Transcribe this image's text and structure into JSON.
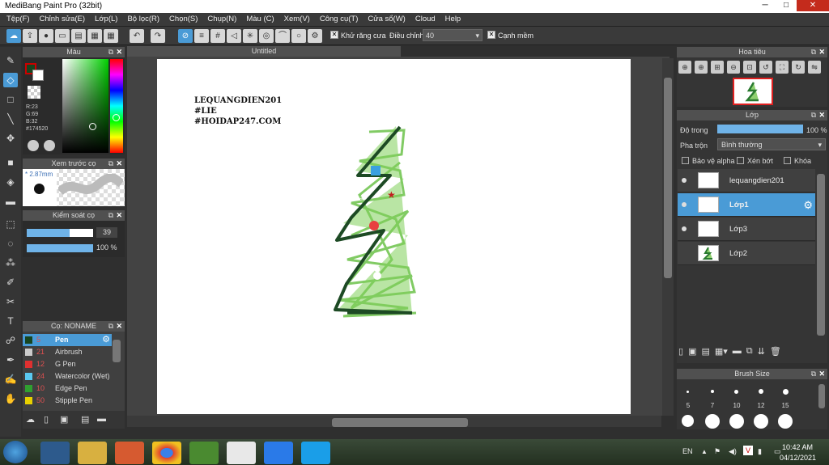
{
  "window": {
    "title": "MediBang Paint Pro (32bit)",
    "min": "─",
    "max": "□",
    "close": "✕"
  },
  "menu": [
    "Tệp(F)",
    "Chỉnh sửa(E)",
    "Lớp(L)",
    "Bộ lọc(R)",
    "Chọn(S)",
    "Chụp(N)",
    "Màu (C)",
    "Xem(V)",
    "Công cụ(T)",
    "Cửa sổ(W)",
    "Cloud",
    "Help"
  ],
  "toolbar": {
    "antialias_label": "Khử răng cưa",
    "adjust_label": "Điều chỉnh",
    "adjust_value": "40",
    "sharp_label": "Cạnh mềm"
  },
  "color_panel": {
    "title": "Màu",
    "r": "R:23",
    "g": "G:69",
    "b": "B:32",
    "hex": "#174520",
    "current_color": "#174520"
  },
  "brush_preview": {
    "title": "Xem trước cọ",
    "size": "* 2.87mm"
  },
  "brush_control": {
    "title": "Kiểm soát cọ",
    "size_value": "39",
    "opacity_value": "100 %",
    "size_fraction": 0.39,
    "opacity_fraction": 1.0
  },
  "brush_list": {
    "title": "Cọ: NONAME",
    "items": [
      {
        "size": "5",
        "name": "Pen",
        "color": "#174520"
      },
      {
        "size": "21",
        "name": "Airbrush",
        "color": "#cccccc"
      },
      {
        "size": "12",
        "name": "G Pen",
        "color": "#e03030"
      },
      {
        "size": "24",
        "name": "Watercolor (Wet)",
        "color": "#5ac8f0"
      },
      {
        "size": "10",
        "name": "Edge Pen",
        "color": "#30a030"
      },
      {
        "size": "50",
        "name": "Stipple Pen",
        "color": "#e8d000"
      }
    ]
  },
  "document": {
    "tab": "Untitled",
    "text_lines": [
      "LEQUANGDIEN201",
      "#LIE",
      "#HOIDAP247.COM"
    ]
  },
  "navigator": {
    "title": "Hoa tiêu"
  },
  "layer_panel": {
    "title": "Lớp",
    "opacity_label": "Độ trong",
    "opacity_value": "100 %",
    "blend_label": "Pha trộn",
    "blend_value": "Bình thường",
    "protect_alpha": "Bảo vệ alpha",
    "clip": "Xén bớt",
    "lock": "Khóa",
    "layers": [
      {
        "name": "lequangdien201"
      },
      {
        "name": "Lớp1"
      },
      {
        "name": "Lớp3"
      },
      {
        "name": "Lớp2"
      }
    ]
  },
  "brush_size_panel": {
    "title": "Brush Size",
    "sizes": [
      "5",
      "7",
      "10",
      "12",
      "15"
    ]
  },
  "taskbar": {
    "lang": "EN",
    "time": "10:42 AM",
    "date": "04/12/2021"
  },
  "icons": [
    "brush-icon",
    "eraser-icon",
    "rectangle-icon",
    "move-icon",
    "fill-icon",
    "text-icon",
    "hand-icon",
    "eyedropper-icon",
    "wand-icon"
  ]
}
